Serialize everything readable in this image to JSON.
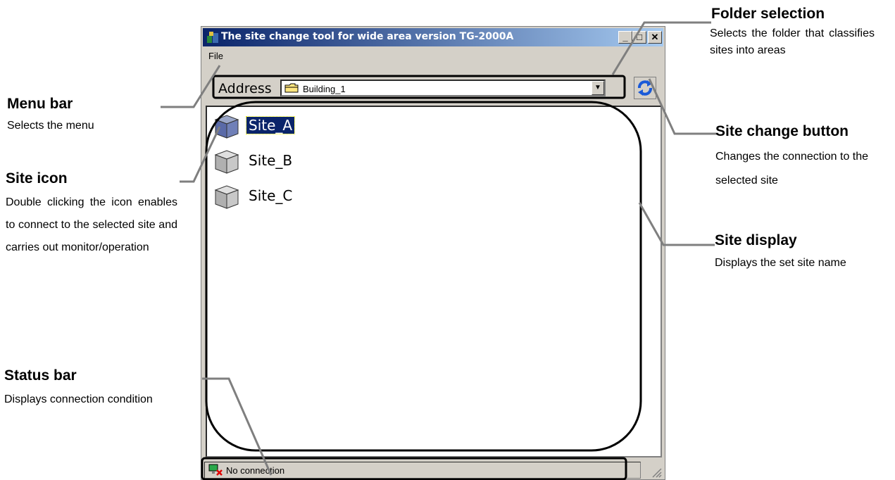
{
  "window": {
    "title": "The site change tool for wide area version TG-2000A",
    "controls": {
      "minimize": "_",
      "maximize": "□",
      "close": "✕"
    }
  },
  "menu": {
    "file": "File"
  },
  "address": {
    "label": "Address",
    "value": "Building_1"
  },
  "sites": [
    {
      "name": "Site_A",
      "selected": true
    },
    {
      "name": "Site_B",
      "selected": false
    },
    {
      "name": "Site_C",
      "selected": false
    }
  ],
  "statusbar": {
    "text": "No connection"
  },
  "annotations": {
    "folder_selection": {
      "title": "Folder selection",
      "desc": "Selects the folder that classifies sites into areas"
    },
    "menu_bar": {
      "title": "Menu bar",
      "desc": "Selects the menu"
    },
    "site_change_button": {
      "title": "Site change button",
      "desc": "Changes the connection to the selected site"
    },
    "site_icon": {
      "title": "Site icon",
      "desc": "Double clicking the icon enables to connect to the selected site and carries out monitor/operation"
    },
    "site_display": {
      "title": "Site display",
      "desc": "Displays the set site name"
    },
    "status_bar": {
      "title": "Status bar",
      "desc": "Displays connection condition"
    }
  },
  "colors": {
    "titlebar_start": "#0a246a",
    "titlebar_end": "#a6caf0",
    "selection": "#0a246a",
    "window_face": "#d4d0c8"
  }
}
